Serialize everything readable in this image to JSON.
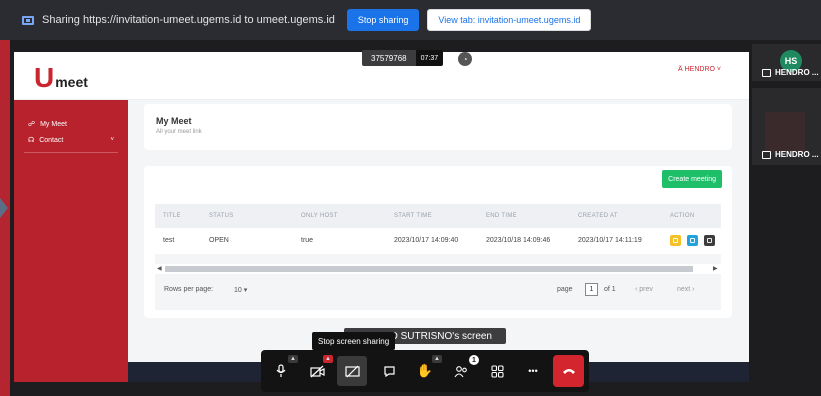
{
  "share_bar": {
    "text": "Sharing https://invitation-umeet.ugems.id to umeet.ugems.id",
    "stop_button": "Stop sharing",
    "view_tab_button": "View tab: invitation-umeet.ugems.id"
  },
  "meeting": {
    "id": "37579768",
    "timer": "07:37",
    "screen_label": "D SUTRISNO's screen",
    "tooltip": "Stop screen sharing",
    "participants_count": "1",
    "thumbnails": [
      {
        "avatar": "HS",
        "name": "HENDRO ..."
      },
      {
        "name": "HENDRO ..."
      }
    ]
  },
  "website": {
    "logo_letter": "U",
    "logo_text": "meet",
    "user_menu": "Ä HENDRO ˅",
    "sidebar": [
      {
        "label": "My Meet",
        "icon": "link-icon"
      },
      {
        "label": "Contact",
        "icon": "headset-icon",
        "chevron": "˅"
      }
    ],
    "page_title": "My Meet",
    "page_subtitle": "All your meet link",
    "create_button": "Create meeting",
    "table": {
      "headers": [
        "TITLE",
        "STATUS",
        "ONLY HOST",
        "START TIME",
        "END TIME",
        "CREATED AT",
        "ACTION"
      ],
      "rows": [
        [
          "test",
          "OPEN",
          "true",
          "2023/10/17 14:09:40",
          "2023/10/18 14:09:46",
          "2023/10/17 14:11:19"
        ]
      ],
      "action_colors": [
        "#f5c12b",
        "#23a3dd",
        "#3d3d3d"
      ]
    },
    "pagination": {
      "rows_per_page_label": "Rows per page:",
      "rows_per_page_value": "10 ▾",
      "page_label": "page",
      "page_value": "1",
      "of_label": "of 1",
      "prev": "‹ prev",
      "next": "next ›"
    }
  },
  "colors": {
    "brand_red": "#b8222c",
    "share_blue": "#1a73e8",
    "create_green": "#1fbf6a",
    "hangup_red": "#d2252d"
  }
}
